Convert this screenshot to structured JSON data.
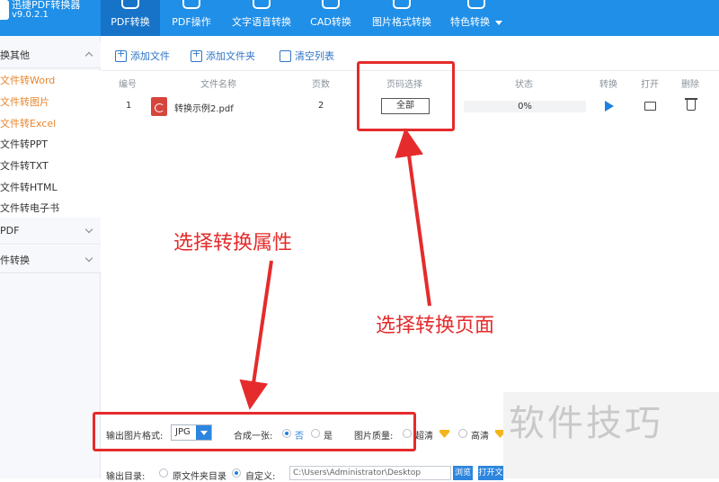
{
  "app": {
    "title": "迅捷PDF转换器",
    "version": "v9.0.2.1"
  },
  "nav_tabs": [
    {
      "label": "PDF转换"
    },
    {
      "label": "PDF操作"
    },
    {
      "label": "文字语音转换"
    },
    {
      "label": "CAD转换"
    },
    {
      "label": "图片格式转换"
    },
    {
      "label": "特色转换"
    }
  ],
  "sidebar": {
    "group_other": "换其他",
    "items": [
      "文件转Word",
      "文件转图片",
      "文件转Excel",
      "文件转PPT",
      "文件转TXT",
      "文件转HTML",
      "文件转电子书"
    ],
    "group_pdf": "PDF",
    "group_convert": "件转换"
  },
  "toolbar": {
    "add_file": "添加文件",
    "add_folder": "添加文件夹",
    "clear_list": "清空列表"
  },
  "table": {
    "headers": {
      "num": "编号",
      "name": "文件名称",
      "pages": "页数",
      "page_select": "页码选择",
      "status": "状态",
      "convert": "转换",
      "open": "打开",
      "delete": "删除"
    },
    "rows": [
      {
        "num": "1",
        "name": "转换示例2.pdf",
        "pages": "2",
        "page_select": "全部",
        "progress": "0%",
        "progress_value": 0
      }
    ]
  },
  "annotations": {
    "left": "选择转换属性",
    "right": "选择转换页面",
    "color": "#e52b2b"
  },
  "settings": {
    "format_label": "输出图片格式:",
    "format_value": "JPG",
    "merge_label": "合成一张:",
    "merge_no": "否",
    "merge_yes": "是",
    "quality_label": "图片质量:",
    "quality_ultra": "超清",
    "quality_high": "高清"
  },
  "output": {
    "label": "输出目录:",
    "option_source": "原文件夹目录",
    "option_custom": "自定义:",
    "path": "C:\\Users\\Administrator\\Desktop",
    "browse": "浏览",
    "open": "打开文"
  },
  "watermark": "软件技巧",
  "colors": {
    "topbar": "#1f8fe8",
    "accent": "#2d86de",
    "highlight": "#e8862e"
  }
}
